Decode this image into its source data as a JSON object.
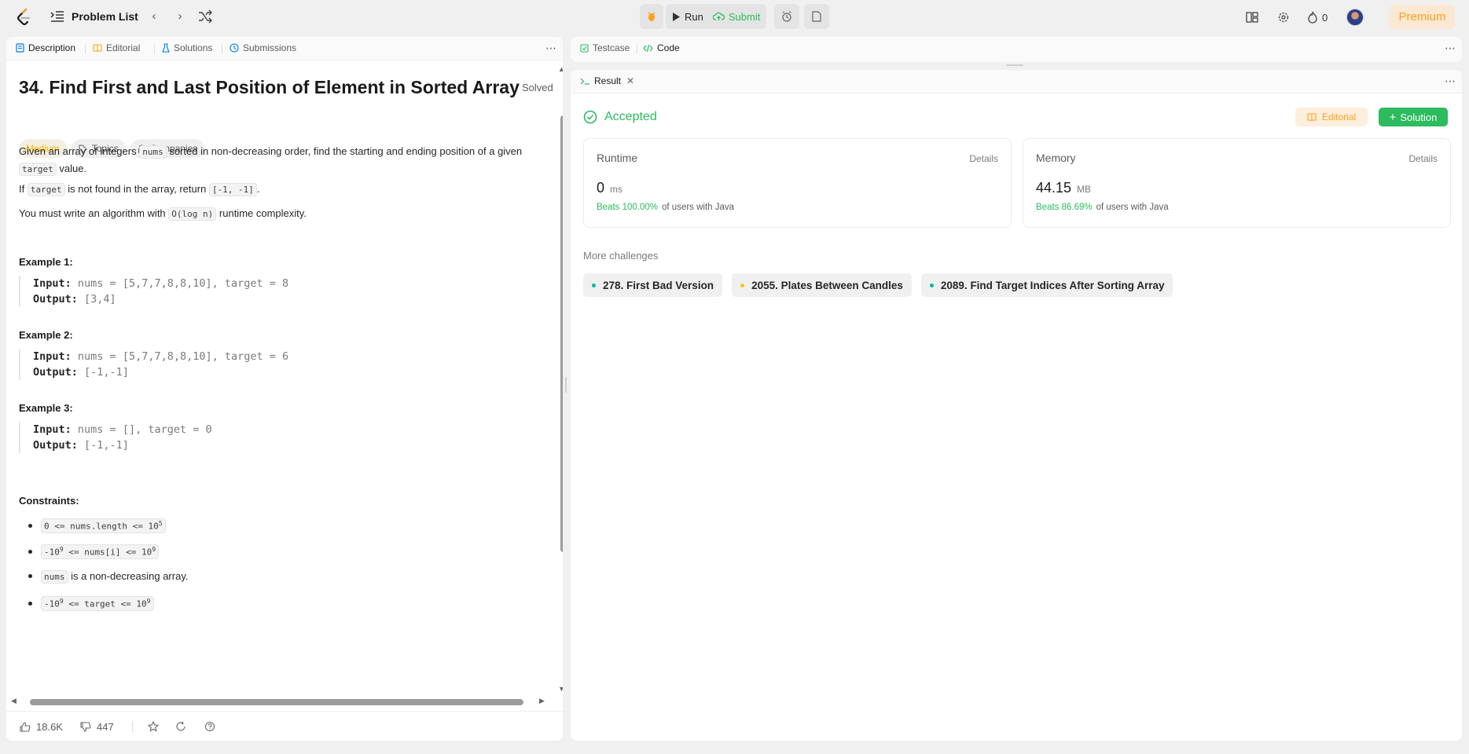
{
  "topnav": {
    "problem_list_label": "Problem List",
    "run_label": "Run",
    "submit_label": "Submit",
    "streak_count": "0",
    "premium_label": "Premium"
  },
  "description_tabs": [
    {
      "label": "Description",
      "icon": "description-icon",
      "color": "#007bff"
    },
    {
      "label": "Editorial",
      "icon": "book-icon",
      "color": "#ffa116"
    },
    {
      "label": "Solutions",
      "icon": "flask-icon",
      "color": "#007bff"
    },
    {
      "label": "Submissions",
      "icon": "history-icon",
      "color": "#007bff"
    }
  ],
  "problem": {
    "title": "34. Find First and Last Position of Element in Sorted Array",
    "solved_label": "Solved",
    "difficulty": "Medium",
    "topics_label": "Topics",
    "companies_label": "Companies",
    "desc_p1_a": "Given an array of integers",
    "desc_p1_code1": "nums",
    "desc_p1_b": "sorted in non-decreasing order, find the starting and ending position of a",
    "desc_p1_c": "given",
    "desc_p1_code2": "target",
    "desc_p1_d": "value.",
    "desc_p2_a": "If",
    "desc_p2_code1": "target",
    "desc_p2_b": "is not found in the array, return",
    "desc_p2_code2": "[-1, -1]",
    "desc_p2_c": ".",
    "desc_p3_a": "You must write an algorithm with",
    "desc_p3_code": "O(log n)",
    "desc_p3_b": "runtime complexity.",
    "examples": [
      {
        "heading": "Example 1:",
        "input_label": "Input:",
        "input": "nums = [5,7,7,8,8,10], target = 8",
        "output_label": "Output:",
        "output": "[3,4]"
      },
      {
        "heading": "Example 2:",
        "input_label": "Input:",
        "input": "nums = [5,7,7,8,8,10], target = 6",
        "output_label": "Output:",
        "output": "[-1,-1]"
      },
      {
        "heading": "Example 3:",
        "input_label": "Input:",
        "input": "nums = [], target = 0",
        "output_label": "Output:",
        "output": "[-1,-1]"
      }
    ],
    "constraints_heading": "Constraints:",
    "constraint1": "0 <= nums.length <= 10",
    "constraint1_sup": "5",
    "constraint2_a": "-10",
    "constraint2_sup1": "9",
    "constraint2_b": " <= nums[i] <= 10",
    "constraint2_sup2": "9",
    "constraint3_code": "nums",
    "constraint3_text": "is a non-decreasing array.",
    "constraint4_a": "-10",
    "constraint4_sup1": "9",
    "constraint4_b": " <= target <= 10",
    "constraint4_sup2": "9"
  },
  "bottombar": {
    "likes": "18.6K",
    "dislikes": "447"
  },
  "testcase_tabs": {
    "testcase_label": "Testcase",
    "code_label": "Code"
  },
  "result": {
    "tab_label": "Result",
    "status": "Accepted",
    "editorial_button": "Editorial",
    "solution_button": "Solution",
    "runtime": {
      "heading": "Runtime",
      "details": "Details",
      "value": "0",
      "unit": "ms",
      "beats": "Beats 100.00%",
      "beats_suffix": "of users with Java"
    },
    "memory": {
      "heading": "Memory",
      "details": "Details",
      "value": "44.15",
      "unit": "MB",
      "beats": "Beats 86.69%",
      "beats_suffix": "of users with Java"
    },
    "more_challenges_label": "More challenges",
    "challenges": [
      {
        "label": "278. First Bad Version",
        "color": "#00b8a3"
      },
      {
        "label": "2055. Plates Between Candles",
        "color": "#ffc01e"
      },
      {
        "label": "2089. Find Target Indices After Sorting Array",
        "color": "#00b8a3"
      }
    ]
  }
}
